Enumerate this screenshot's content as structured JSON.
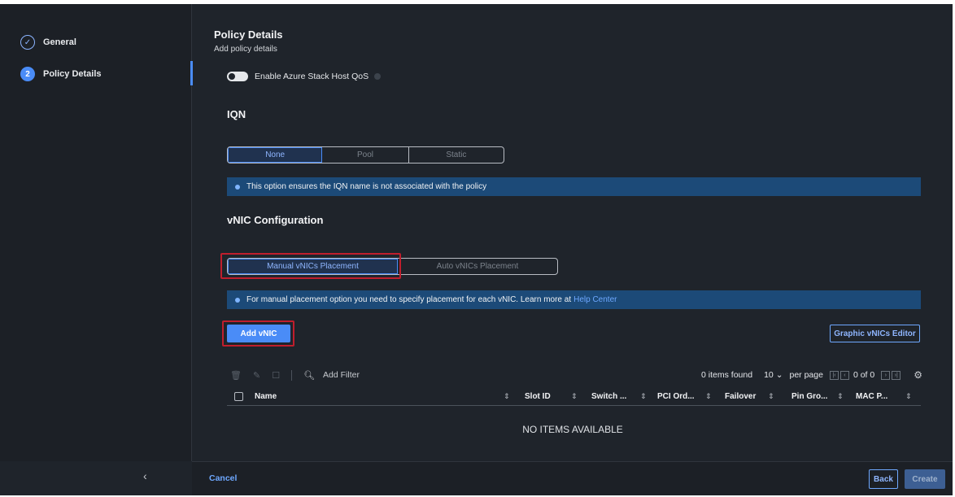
{
  "steps": [
    {
      "label": "General",
      "marker": "✓"
    },
    {
      "label": "Policy Details",
      "marker": "2"
    }
  ],
  "header": {
    "title": "Policy Details",
    "subtitle": "Add policy details"
  },
  "azure_toggle": {
    "label": "Enable Azure Stack Host QoS",
    "enabled": false
  },
  "iqn": {
    "title": "IQN",
    "options": [
      "None",
      "Pool",
      "Static"
    ],
    "selected": "None",
    "banner": "This option ensures the IQN name is not associated with the policy"
  },
  "vnic": {
    "title": "vNIC Configuration",
    "options": [
      "Manual vNICs Placement",
      "Auto vNICs Placement"
    ],
    "selected": "Manual vNICs Placement",
    "banner": "For manual placement option you need to specify placement for each vNIC. Learn more at",
    "banner_link": "Help Center",
    "add_button": "Add vNIC",
    "graphic_editor_button": "Graphic vNICs Editor"
  },
  "table": {
    "filter_placeholder": "Add Filter",
    "items_found": "0 items found",
    "per_page_value": "10",
    "per_page_label": "per page",
    "page_info": "0 of 0",
    "columns": [
      "Name",
      "Slot ID",
      "Switch ...",
      "PCI Ord...",
      "Failover",
      "Pin Gro...",
      "MAC P..."
    ],
    "empty_text": "NO ITEMS AVAILABLE"
  },
  "footer": {
    "cancel": "Cancel",
    "back": "Back",
    "create": "Create"
  },
  "colors": {
    "accent": "#4a8cf7",
    "highlight": "#c01e2d",
    "banner": "#1c4a78"
  }
}
